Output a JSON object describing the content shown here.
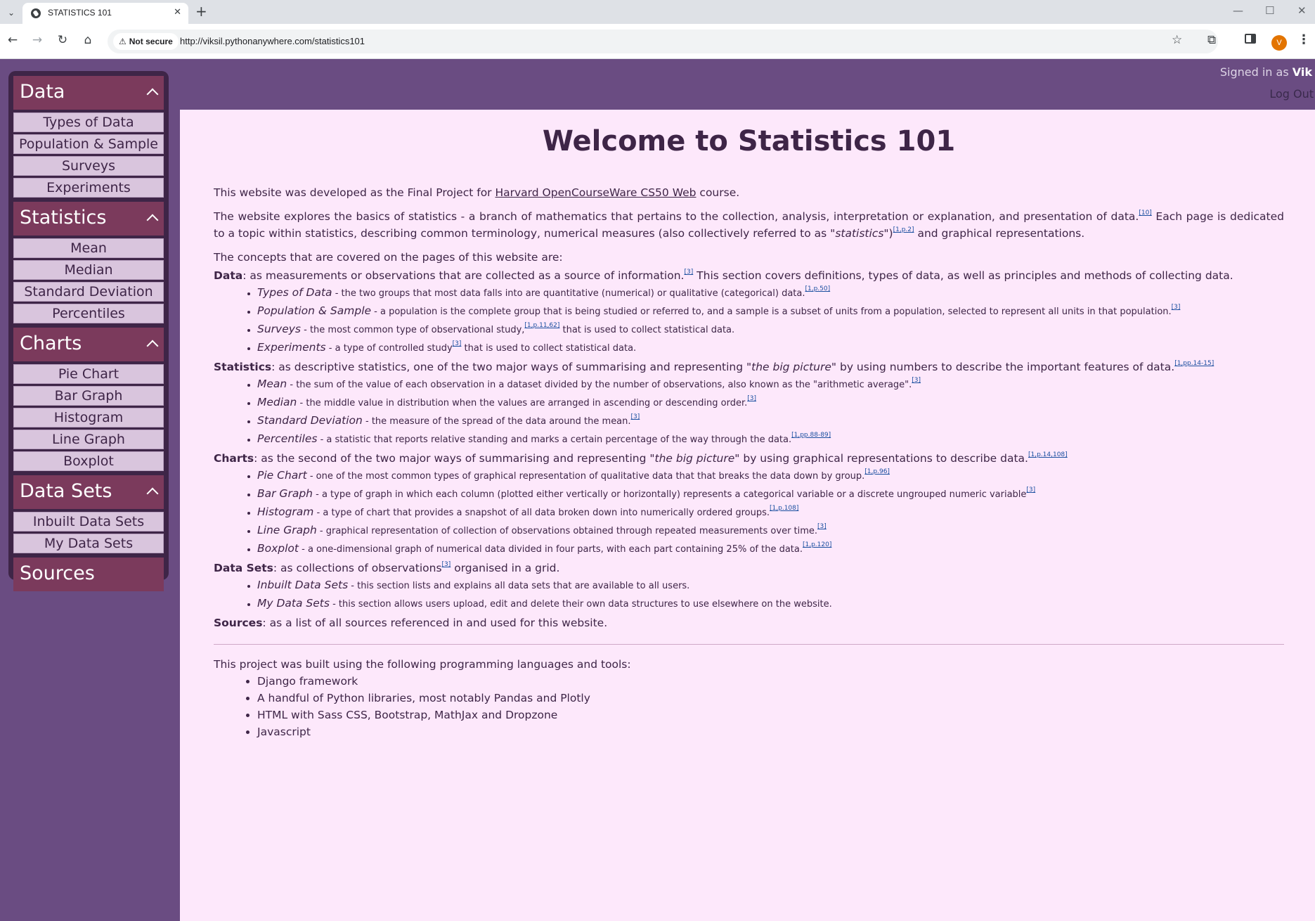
{
  "browser": {
    "tab_title": "STATISTICS 101",
    "tab_close": "✕",
    "new_tab": "+",
    "security_label": "Not secure",
    "url": "http://viksil.pythonanywhere.com/statistics101",
    "profile_initial": "V"
  },
  "header": {
    "signed_in_prefix": "Signed in as ",
    "user": "Vik",
    "logout": "Log Out"
  },
  "sidebar": {
    "sections": [
      {
        "title": "Data",
        "items": [
          "Types of Data",
          "Population & Sample",
          "Surveys",
          "Experiments"
        ]
      },
      {
        "title": "Statistics",
        "items": [
          "Mean",
          "Median",
          "Standard Deviation",
          "Percentiles"
        ]
      },
      {
        "title": "Charts",
        "items": [
          "Pie Chart",
          "Bar Graph",
          "Histogram",
          "Line Graph",
          "Boxplot"
        ]
      },
      {
        "title": "Data Sets",
        "items": [
          "Inbuilt Data Sets",
          "My Data Sets"
        ]
      }
    ],
    "sources": "Sources"
  },
  "main": {
    "title": "Welcome to Statistics 101",
    "intro_pre": "This website was developed as the Final Project for ",
    "intro_link": "Harvard OpenCourseWare CS50 Web",
    "intro_post": " course.",
    "explore_1": "The website explores the basics of statistics - a branch of mathematics that pertains to the collection, analysis, interpretation or explanation, and presentation of data.",
    "explore_ref1": "[10]",
    "explore_2": " Each page is dedicated to a topic within statistics, describing common terminology, numerical measures (also collectively referred to as \"",
    "explore_italic": "statistics",
    "explore_3": "\")",
    "explore_ref2": "[1,p.2]",
    "explore_4": " and graphical representations.",
    "concepts_intro": "The concepts that are covered on the pages of this website are:",
    "categories": [
      {
        "name": "Data",
        "desc_1": ": as measurements or observations that are collected as a source of information.",
        "ref": "[3]",
        "desc_2": " This section covers definitions, types of data, as well as principles and methods of collecting data.",
        "items": [
          {
            "term": "Types of Data",
            "text": " - the two groups that most data falls into are quantitative (numerical) or qualitative (categorical) data.",
            "ref": "[1,p.50]",
            "tail": ""
          },
          {
            "term": "Population & Sample",
            "text": " - a population is the complete group that is being studied or referred to, and a sample is a subset of units from a population, selected to represent all units in that population.",
            "ref": "[3]",
            "tail": ""
          },
          {
            "term": "Surveys",
            "text": " - the most common type of observational study,",
            "ref": "[1,p.11,62]",
            "tail": " that is used to collect statistical data."
          },
          {
            "term": "Experiments",
            "text": " - a type of controlled study",
            "ref": "[3]",
            "tail": " that is used to collect statistical data."
          }
        ]
      },
      {
        "name": "Statistics",
        "desc_1": ": as descriptive statistics, one of the two major ways of summarising and representing \"",
        "italic": "the big picture",
        "desc_2": "\" by using numbers to describe the important features of data.",
        "ref": "[1,pp.14-15]",
        "items": [
          {
            "term": "Mean",
            "text": " - the sum of the value of each observation in a dataset divided by the number of observations, also known as the \"arithmetic average\".",
            "ref": "[3]",
            "tail": ""
          },
          {
            "term": "Median",
            "text": " - the middle value in distribution when the values are arranged in ascending or descending order.",
            "ref": "[3]",
            "tail": ""
          },
          {
            "term": "Standard Deviation",
            "text": " - the measure of the spread of the data around the mean.",
            "ref": "[3]",
            "tail": ""
          },
          {
            "term": "Percentiles",
            "text": " - a statistic that reports relative standing and marks a certain percentage of the way through the data.",
            "ref": "[1,pp.88-89]",
            "tail": ""
          }
        ]
      },
      {
        "name": "Charts",
        "desc_1": ": as the second of the two major ways of summarising and representing \"",
        "italic": "the big picture",
        "desc_2": "\" by using graphical representations to describe data.",
        "ref": "[1,p.14,108]",
        "items": [
          {
            "term": "Pie Chart",
            "text": " - one of the most common types of graphical representation of qualitative data that that breaks the data down by group.",
            "ref": "[1,p.96]",
            "tail": ""
          },
          {
            "term": "Bar Graph",
            "text": " - a type of graph in which each column (plotted either vertically or horizontally) represents a categorical variable or a discrete ungrouped numeric variable",
            "ref": "[3]",
            "tail": ""
          },
          {
            "term": "Histogram",
            "text": " - a type of chart that provides a snapshot of all data broken down into numerically ordered groups.",
            "ref": "[1,p.108]",
            "tail": ""
          },
          {
            "term": "Line Graph",
            "text": " - graphical representation of collection of observations obtained through repeated measurements over time.",
            "ref": "[3]",
            "tail": ""
          },
          {
            "term": "Boxplot",
            "text": " - a one-dimensional graph of numerical data divided in four parts, with each part containing 25% of the data.",
            "ref": "[1,p.120]",
            "tail": ""
          }
        ]
      },
      {
        "name": "Data Sets",
        "desc_1": ": as collections of observations",
        "ref": "[3]",
        "desc_2": " organised in a grid.",
        "items": [
          {
            "term": "Inbuilt Data Sets",
            "text": " - this section lists and explains all data sets that are available to all users.",
            "ref": "",
            "tail": ""
          },
          {
            "term": "My Data Sets",
            "text": " - this section allows users upload, edit and delete their own data structures to use elsewhere on the website.",
            "ref": "",
            "tail": ""
          }
        ]
      }
    ],
    "sources_name": "Sources",
    "sources_desc": ": as a list of all sources referenced in and used for this website.",
    "tools_intro": "This project was built using the following programming languages and tools:",
    "tools": [
      "Django framework",
      "A handful of Python libraries, most notably Pandas and Plotly",
      "HTML with Sass CSS, Bootstrap, MathJax and Dropzone",
      "Javascript"
    ]
  }
}
